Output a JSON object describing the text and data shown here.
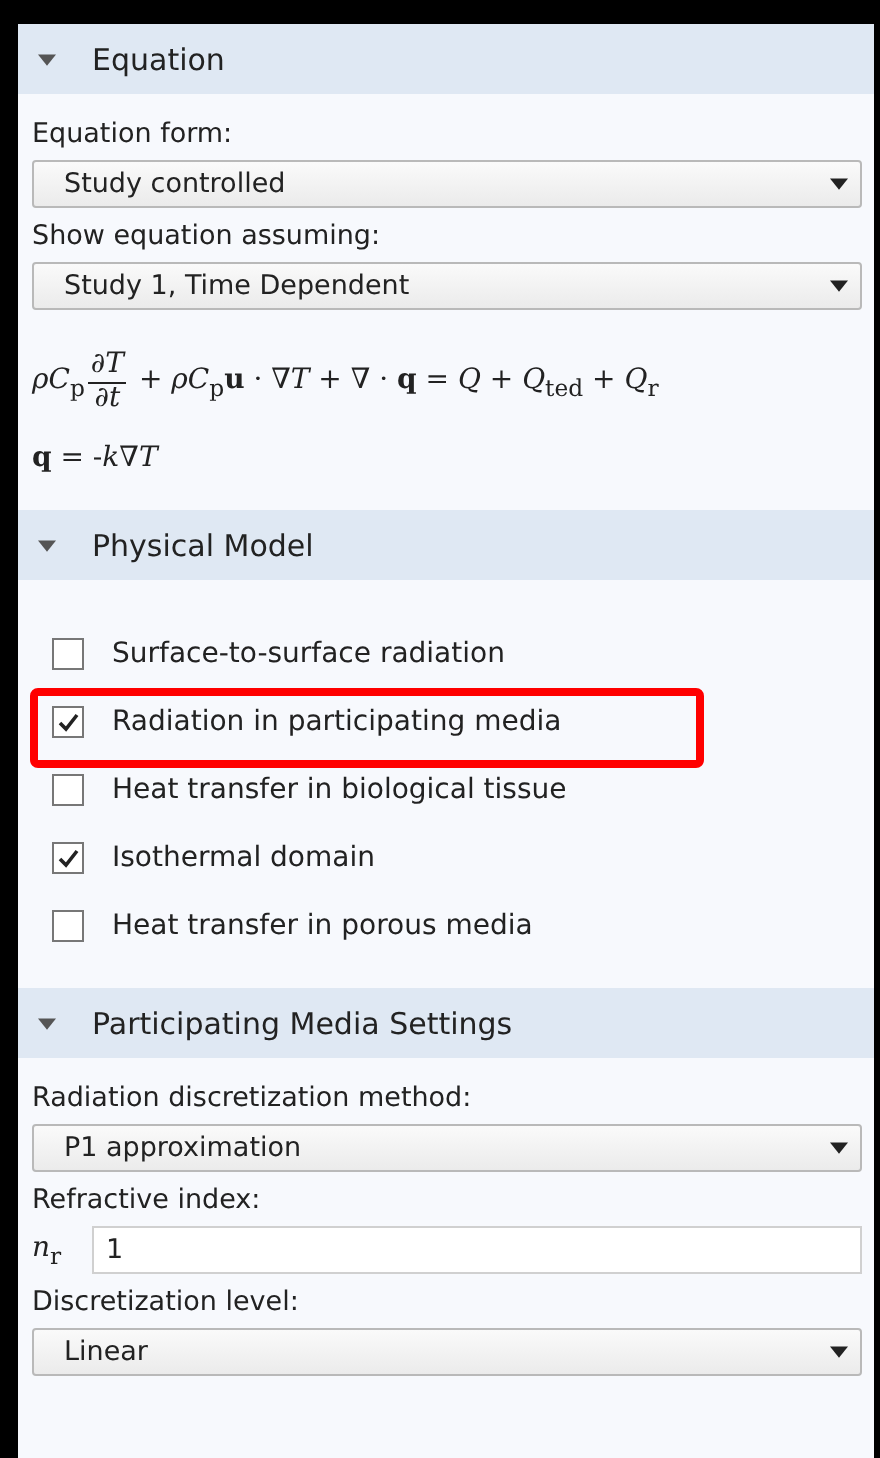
{
  "sections": [
    {
      "title": "Equation",
      "expanded": true,
      "fields": [
        {
          "kind": "select",
          "label": "Equation form:",
          "value": "Study controlled"
        },
        {
          "kind": "select",
          "label": "Show equation assuming:",
          "value": "Study 1, Time Dependent"
        }
      ],
      "equations": [
        {
          "lead": "*ρC*$_{p}$",
          "numerator": "*∂T*",
          "denominator": "*∂t*",
          "rest": " + *ρC*$_{p}$**u** · ∇*T* + ∇ · **q** = *Q* + *Q*$_{ted}$ + *Q*$_{r}$"
        },
        {
          "lead": "**q** = -*k*∇*T*"
        }
      ]
    },
    {
      "title": "Physical Model",
      "expanded": true,
      "options": [
        {
          "label": "Surface-to-surface radiation",
          "checked": false,
          "highlighted": false
        },
        {
          "label": "Radiation in participating media",
          "checked": true,
          "highlighted": true
        },
        {
          "label": "Heat transfer in biological tissue",
          "checked": false,
          "highlighted": false
        },
        {
          "label": "Isothermal domain",
          "checked": true,
          "highlighted": false
        },
        {
          "label": "Heat transfer in porous media",
          "checked": false,
          "highlighted": false
        }
      ]
    },
    {
      "title": "Participating Media Settings",
      "expanded": true,
      "fields": [
        {
          "kind": "select",
          "label": "Radiation discretization method:",
          "value": "P1 approximation"
        },
        {
          "kind": "input",
          "label": "Refractive index:",
          "symbol": "*n*$_{r}$",
          "value": "1"
        },
        {
          "kind": "select",
          "label": "Discretization level:",
          "value": "Linear"
        }
      ]
    }
  ]
}
